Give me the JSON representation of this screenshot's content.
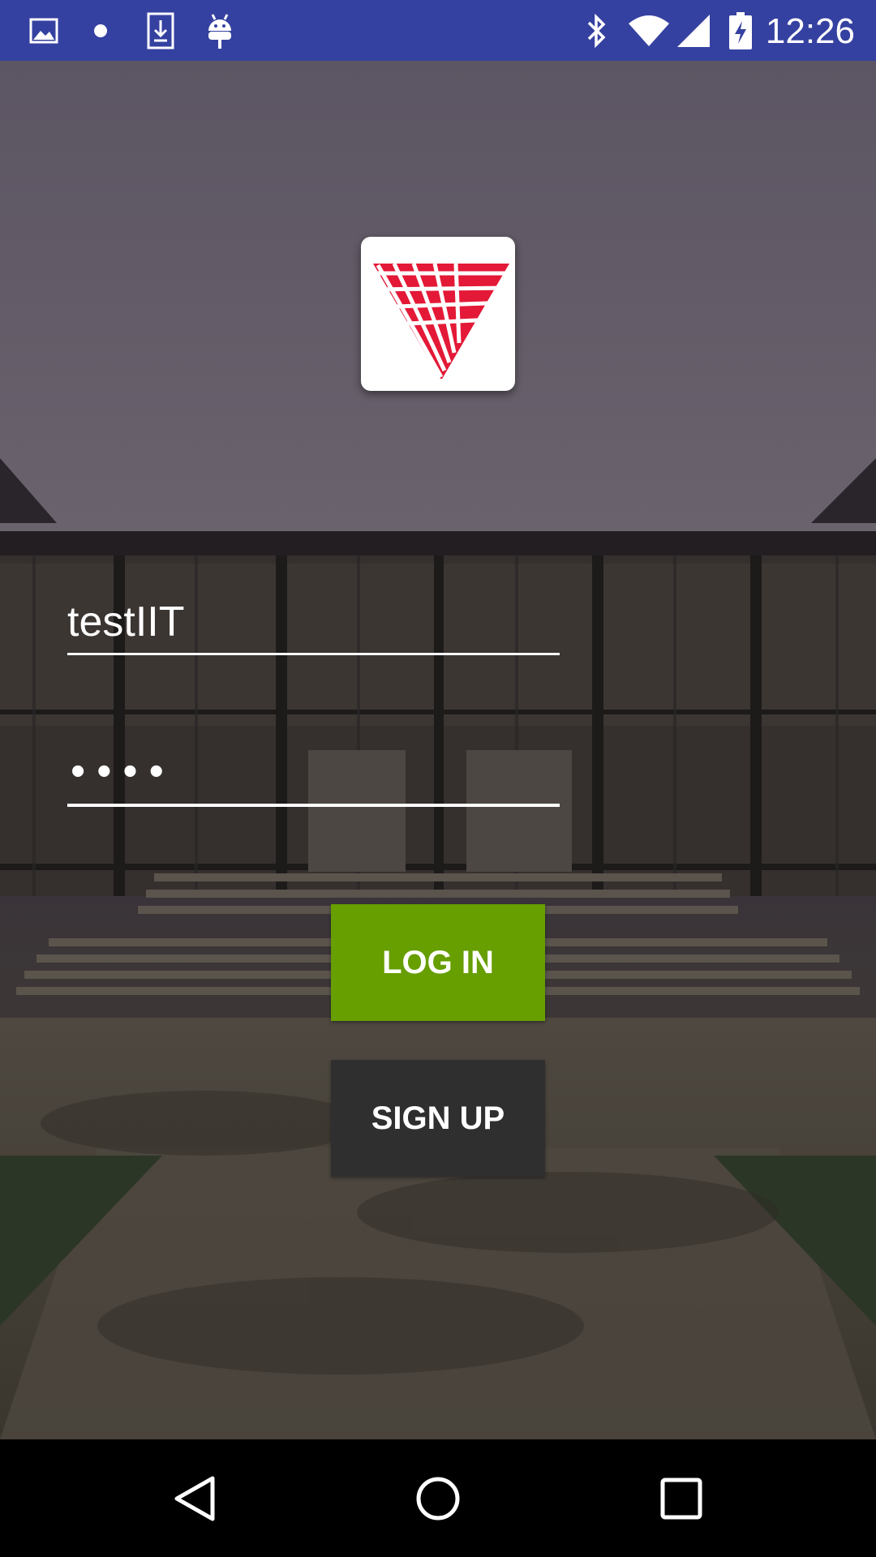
{
  "status_bar": {
    "time": "12:26",
    "left_icons": [
      "image-icon",
      "dot-icon",
      "download-icon",
      "android-icon"
    ],
    "right_icons": [
      "bluetooth-icon",
      "wifi-icon",
      "signal-icon",
      "battery-charging-icon"
    ]
  },
  "logo": {
    "icon": "triangle-logo-icon",
    "color": "#e31937"
  },
  "login_form": {
    "username_value": "testIIT",
    "password_value": "••••"
  },
  "buttons": {
    "login_label": "LOG IN",
    "signup_label": "SIGN UP",
    "login_color": "#679e00",
    "signup_color": "#2f2f2f"
  },
  "nav_bar": {
    "back_icon": "back-icon",
    "home_icon": "home-icon",
    "recents_icon": "recents-icon"
  }
}
